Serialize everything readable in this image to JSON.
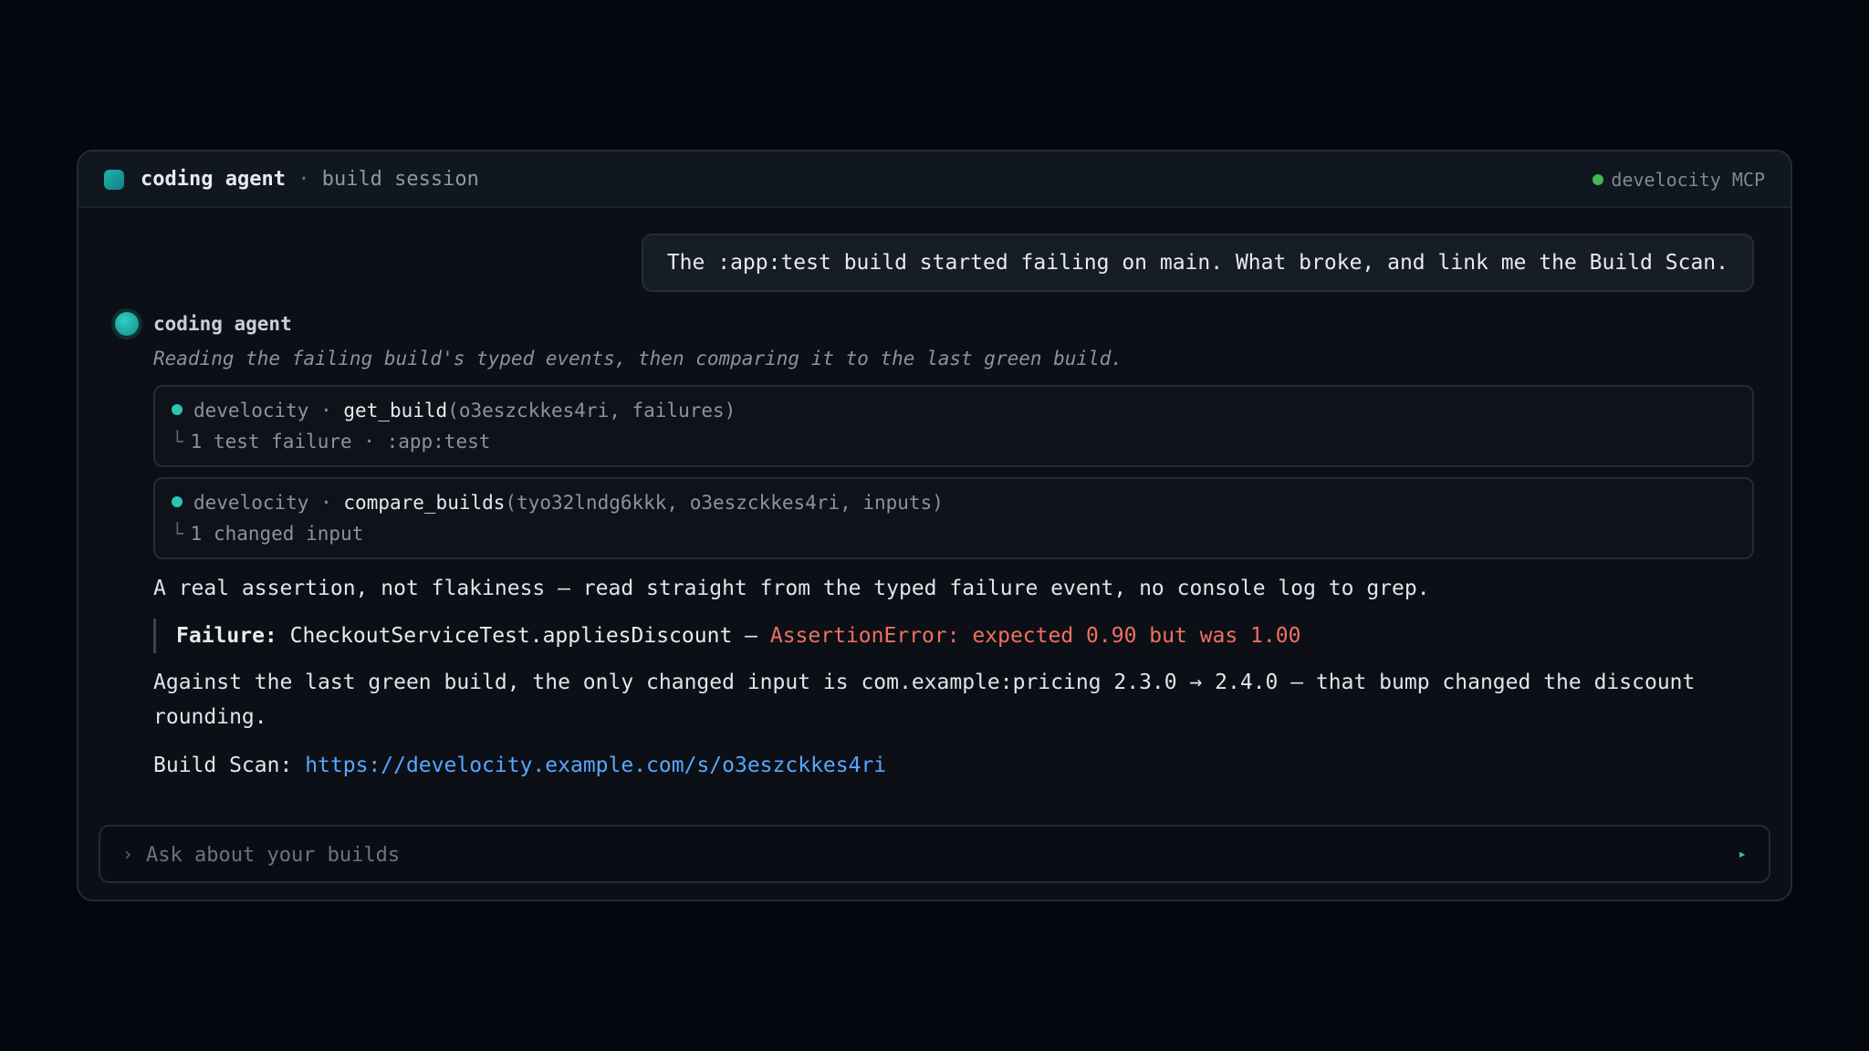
{
  "window": {
    "app_name": "coding agent",
    "separator": "·",
    "session": "build session",
    "status_label": "develocity MCP"
  },
  "user_message": "The :app:test build started failing on main. What broke, and link me the Build Scan.",
  "agent": {
    "name": "coding agent",
    "thought": "Reading the failing build's typed events, then comparing it to the last green build."
  },
  "tool_calls": [
    {
      "server": "develocity",
      "sep": "·",
      "function": "get_build",
      "args": "(o3eszckkes4ri, failures)",
      "branch": "└",
      "result": "1 test failure · :app:test"
    },
    {
      "server": "develocity",
      "sep": "·",
      "function": "compare_builds",
      "args": "(tyo32lndg6kkk, o3eszckkes4ri, inputs)",
      "branch": "└",
      "result": "1 changed input"
    }
  ],
  "answer": {
    "intro": "A real assertion, not flakiness — read straight from the typed failure event, no console log to grep.",
    "failure_label": "Failure:",
    "failure_test": "CheckoutServiceTest.appliesDiscount —",
    "failure_error": "AssertionError: expected 0.90 but was 1.00",
    "comparison": "Against the last green build, the only changed input is com.example:pricing 2.3.0 → 2.4.0 — that bump changed the discount rounding.",
    "scan_label": "Build Scan:",
    "scan_url": "https://develocity.example.com/s/o3eszckkes4ri"
  },
  "input": {
    "chevron": "›",
    "placeholder": "Ask about your builds",
    "send_icon": "▸"
  },
  "colors": {
    "accent": "#2ec4b6",
    "status_ok": "#3fb950",
    "error": "#f0705f",
    "link": "#58a6ff"
  }
}
